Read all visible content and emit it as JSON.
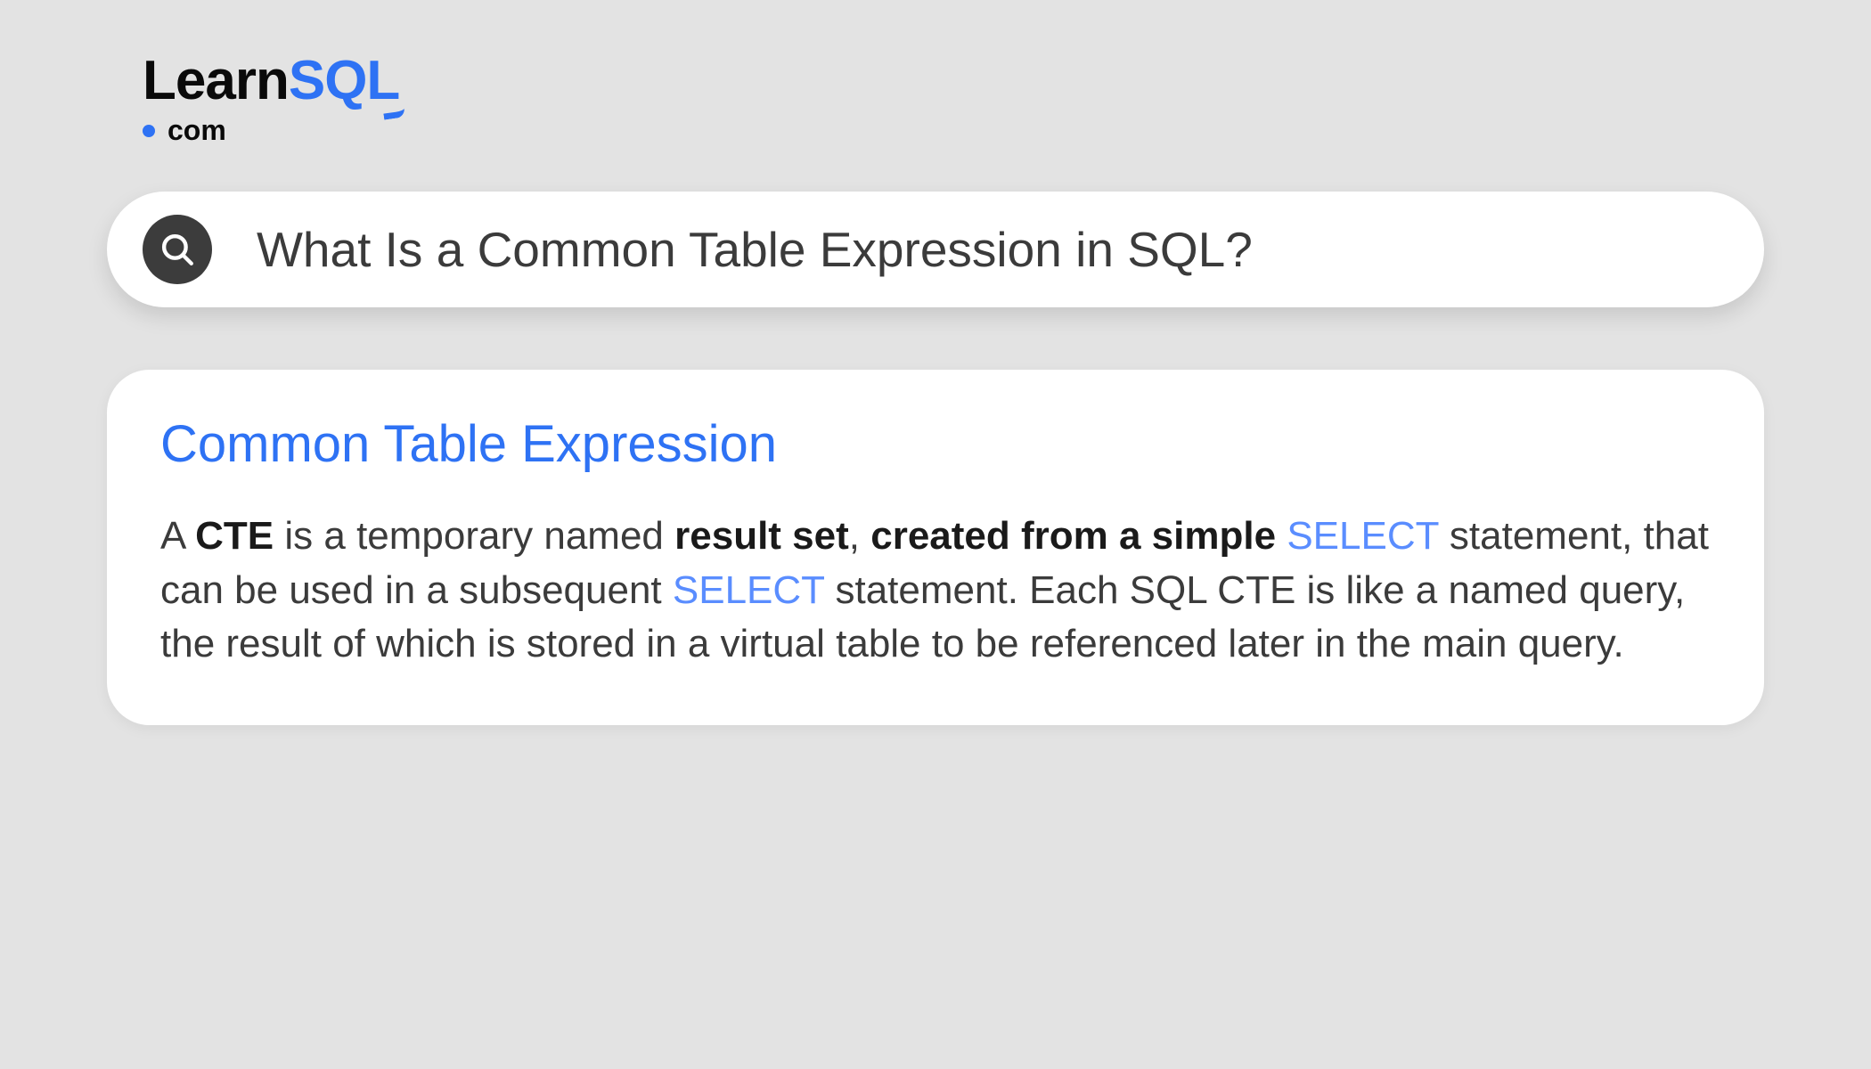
{
  "logo": {
    "part1": "Learn",
    "part2": "SQL",
    "sub": "com"
  },
  "search": {
    "value": "What Is a Common Table Expression in SQL?"
  },
  "result": {
    "title": "Common Table Expression",
    "body": {
      "t1": "A ",
      "b1": "CTE",
      "t2": " is a temporary named ",
      "b2": "result set",
      "t3": ", ",
      "b3": "created from a simple",
      "t4": " ",
      "k1": "SELECT",
      "t5": " statement, that can be used in a subsequent ",
      "k2": "SELECT",
      "t6": " statement. Each SQL CTE is like a named query, the result of which is stored in a virtual table to be referenced later in the main query."
    }
  },
  "colors": {
    "accent": "#2e72f4",
    "keyword": "#5a8dff",
    "text": "#3b3b3b",
    "bg": "#e3e3e3"
  }
}
